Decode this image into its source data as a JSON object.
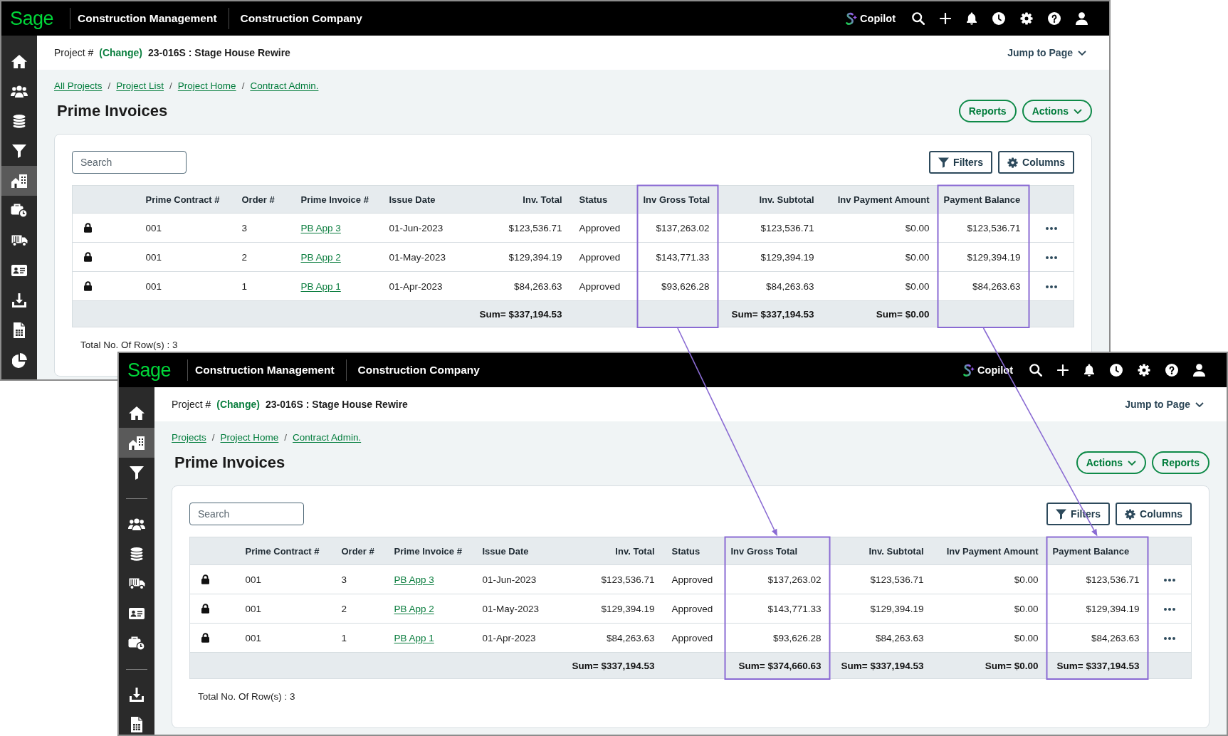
{
  "windows": [
    {
      "header": {
        "logo": "Sage",
        "product": "Construction Management",
        "company": "Construction Company",
        "copilot": "Copilot"
      },
      "sidebar": {
        "items": [
          {
            "kind": "home",
            "selected": false
          },
          {
            "kind": "people",
            "selected": false
          },
          {
            "kind": "coins",
            "selected": false
          },
          {
            "kind": "filter",
            "selected": false
          },
          {
            "kind": "building",
            "selected": true
          },
          {
            "kind": "briefcase",
            "selected": false
          },
          {
            "kind": "truck",
            "selected": false
          },
          {
            "kind": "card",
            "selected": false
          },
          {
            "kind": "download",
            "selected": false
          },
          {
            "kind": "sheet",
            "selected": false
          },
          {
            "kind": "pie",
            "selected": false
          }
        ]
      },
      "project_bar": {
        "label": "Project #",
        "change": "(Change)",
        "project": "23-016S : Stage House Rewire",
        "jump": "Jump to Page"
      },
      "breadcrumbs": [
        {
          "label": "All Projects"
        },
        {
          "separator": "/",
          "label": "Project List"
        },
        {
          "separator": "/",
          "label": "Project Home"
        },
        {
          "separator": "/",
          "label": "Contract Admin."
        }
      ],
      "title": "Prime Invoices",
      "page_actions": [
        {
          "kind": "button",
          "label": "Reports"
        },
        {
          "kind": "menu",
          "label": "Actions"
        }
      ],
      "search": {
        "placeholder": "Search"
      },
      "table_tools": [
        {
          "kind": "filter",
          "label": "Filters"
        },
        {
          "kind": "columns",
          "label": "Columns"
        }
      ],
      "table": {
        "columns": [
          {
            "label": "Prime Contract #",
            "kind": "text",
            "highlighted": false
          },
          {
            "label": "Order #",
            "kind": "text",
            "highlighted": false
          },
          {
            "label": "Prime Invoice #",
            "kind": "link",
            "highlighted": false
          },
          {
            "label": "Issue Date",
            "kind": "text",
            "highlighted": false
          },
          {
            "label": "Inv. Total",
            "kind": "amount",
            "highlighted": false
          },
          {
            "label": "Status",
            "kind": "text",
            "highlighted": false
          },
          {
            "label": "Inv Gross Total",
            "kind": "amount",
            "highlighted": true
          },
          {
            "label": "Inv. Subtotal",
            "kind": "amount",
            "highlighted": false
          },
          {
            "label": "Inv Payment Amount",
            "kind": "amount",
            "highlighted": false
          },
          {
            "label": "Payment Balance",
            "kind": "amount",
            "highlighted": true
          }
        ],
        "rows": [
          {
            "kind": "invoice",
            "locked": true,
            "cells": [
              "001",
              "3",
              "PB App 3",
              "01-Jun-2023",
              "$123,536.71",
              "Approved",
              "$137,263.02",
              "$123,536.71",
              "$0.00",
              "$123,536.71"
            ]
          },
          {
            "kind": "invoice",
            "locked": true,
            "cells": [
              "001",
              "2",
              "PB App 2",
              "01-May-2023",
              "$129,394.19",
              "Approved",
              "$143,771.33",
              "$129,394.19",
              "$0.00",
              "$129,394.19"
            ]
          },
          {
            "kind": "invoice",
            "locked": true,
            "cells": [
              "001",
              "1",
              "PB App 1",
              "01-Apr-2023",
              "$84,263.63",
              "Approved",
              "$93,626.28",
              "$84,263.63",
              "$0.00",
              "$84,263.63"
            ]
          },
          {
            "kind": "total",
            "cells": [
              null,
              null,
              null,
              null,
              "Sum= $337,194.53",
              null,
              null,
              "Sum= $337,194.53",
              "Sum= $0.00",
              null
            ]
          }
        ],
        "row_count": "Total No. Of Row(s) : 3"
      }
    },
    {
      "header": {
        "logo": "Sage",
        "product": "Construction Management",
        "company": "Construction Company",
        "copilot": "Copilot"
      },
      "sidebar": {
        "items": [
          {
            "kind": "home",
            "selected": false
          },
          {
            "kind": "building",
            "selected": true
          },
          {
            "kind": "filter",
            "selected": false
          },
          {
            "kind": "divider"
          },
          {
            "kind": "people",
            "selected": false
          },
          {
            "kind": "coins",
            "selected": false
          },
          {
            "kind": "truck",
            "selected": false
          },
          {
            "kind": "card",
            "selected": false
          },
          {
            "kind": "briefcase",
            "selected": false
          },
          {
            "kind": "divider"
          },
          {
            "kind": "download",
            "selected": false
          },
          {
            "kind": "sheet",
            "selected": false
          }
        ]
      },
      "project_bar": {
        "label": "Project #",
        "change": "(Change)",
        "project": "23-016S : Stage House Rewire",
        "jump": "Jump to Page"
      },
      "breadcrumbs": [
        {
          "label": "Projects"
        },
        {
          "separator": "/",
          "label": "Project Home"
        },
        {
          "separator": "/",
          "label": "Contract Admin."
        }
      ],
      "title": "Prime Invoices",
      "page_actions": [
        {
          "kind": "menu",
          "label": "Actions"
        },
        {
          "kind": "button",
          "label": "Reports"
        }
      ],
      "search": {
        "placeholder": "Search"
      },
      "table_tools": [
        {
          "kind": "filter",
          "label": "Filters"
        },
        {
          "kind": "columns",
          "label": "Columns"
        }
      ],
      "table": {
        "columns": [
          {
            "label": "Prime Contract #",
            "kind": "text",
            "highlighted": false
          },
          {
            "label": "Order #",
            "kind": "text",
            "highlighted": false
          },
          {
            "label": "Prime Invoice #",
            "kind": "link",
            "highlighted": false
          },
          {
            "label": "Issue Date",
            "kind": "text",
            "highlighted": false
          },
          {
            "label": "Inv. Total",
            "kind": "amount",
            "highlighted": false
          },
          {
            "label": "Status",
            "kind": "text",
            "highlighted": false
          },
          {
            "label": "Inv Gross Total",
            "kind": "amount",
            "highlighted": true
          },
          {
            "label": "Inv. Subtotal",
            "kind": "amount",
            "highlighted": false
          },
          {
            "label": "Inv Payment Amount",
            "kind": "amount",
            "highlighted": false
          },
          {
            "label": "Payment Balance",
            "kind": "amount",
            "highlighted": true
          }
        ],
        "rows": [
          {
            "kind": "invoice",
            "locked": true,
            "cells": [
              "001",
              "3",
              "PB App 3",
              "01-Jun-2023",
              "$123,536.71",
              "Approved",
              "$137,263.02",
              "$123,536.71",
              "$0.00",
              "$123,536.71"
            ]
          },
          {
            "kind": "invoice",
            "locked": true,
            "cells": [
              "001",
              "2",
              "PB App 2",
              "01-May-2023",
              "$129,394.19",
              "Approved",
              "$143,771.33",
              "$129,394.19",
              "$0.00",
              "$129,394.19"
            ]
          },
          {
            "kind": "invoice",
            "locked": true,
            "cells": [
              "001",
              "1",
              "PB App 1",
              "01-Apr-2023",
              "$84,263.63",
              "Approved",
              "$93,626.28",
              "$84,263.63",
              "$0.00",
              "$84,263.63"
            ]
          },
          {
            "kind": "total",
            "cells": [
              null,
              null,
              null,
              null,
              "Sum= $337,194.53",
              null,
              "Sum= $374,660.63",
              "Sum= $337,194.53",
              "Sum= $0.00",
              "Sum= $337,194.53"
            ]
          }
        ],
        "row_count": "Total No. Of Row(s) : 3"
      }
    }
  ]
}
